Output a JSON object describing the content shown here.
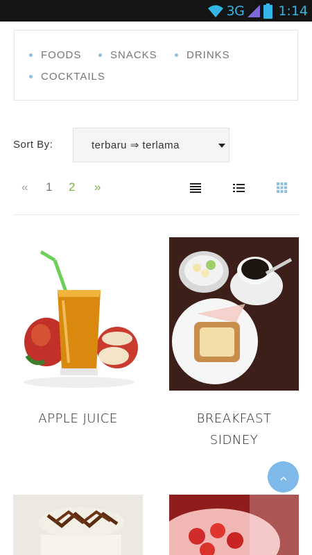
{
  "status_bar": {
    "network": "3G",
    "time": "1:14",
    "icons": [
      "wifi-icon",
      "signal-icon",
      "battery-icon"
    ]
  },
  "categories": [
    {
      "label": "FOODS"
    },
    {
      "label": "SNACKS"
    },
    {
      "label": "DRINKS"
    },
    {
      "label": "COCKTAILS"
    }
  ],
  "sort": {
    "label": "Sort By:",
    "selected": "terbaru ⇒ terlama"
  },
  "pagination": {
    "prev": "«",
    "pages": [
      "1",
      "2"
    ],
    "next": "»",
    "current_page": "2"
  },
  "view_modes": [
    "align-justify-icon",
    "list-icon",
    "grid-icon"
  ],
  "products": [
    {
      "title": "APPLE JUICE",
      "image": "apple-juice-image"
    },
    {
      "title": "BREAKFAST SIDNEY",
      "title_lines": [
        "BREAKFAST",
        "SIDNEY"
      ],
      "image": "breakfast-image"
    },
    {
      "title": "",
      "image": "dessert-image"
    },
    {
      "title": "",
      "image": "strawberry-image"
    }
  ],
  "colors": {
    "accent_green": "#7cb342",
    "dot_blue": "#8fbfe0",
    "scroll_top_bg": "#7fb9ea",
    "status_icon": "#33b5e5",
    "grid_icon_active": "#8fbfe0"
  },
  "scroll_top_icon": "chevron-up-icon"
}
